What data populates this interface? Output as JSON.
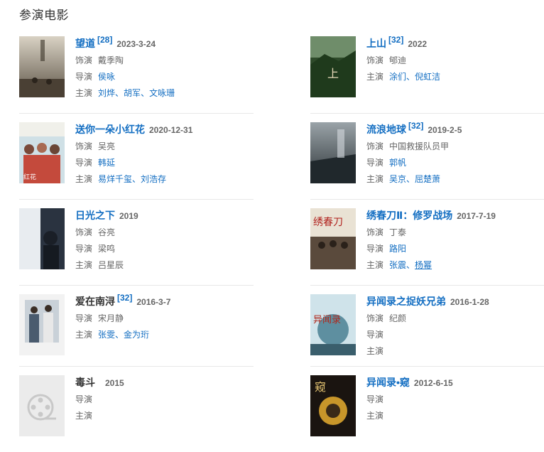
{
  "section_title": "参演电影",
  "labels": {
    "role": "饰演",
    "director": "导演",
    "cast": "主演"
  },
  "movies": [
    {
      "name": "望道",
      "badge": "[28]",
      "date": "2023-3-24",
      "role": "戴季陶",
      "director": "侯咏",
      "cast": [
        "刘烨",
        "胡军",
        "文咏珊"
      ]
    },
    {
      "name": "上山",
      "badge": "[32]",
      "date": "2022",
      "role": "郇迪",
      "cast": [
        "涂们",
        "倪虹洁"
      ]
    },
    {
      "name": "送你一朵小红花",
      "date": "2020-12-31",
      "role": "吴亮",
      "director": "韩延",
      "cast": [
        "易烊千玺",
        "刘浩存"
      ]
    },
    {
      "name": "流浪地球",
      "badge": "[32]",
      "date": "2019-2-5",
      "role": "中国救援队员甲",
      "director": "郭帆",
      "cast": [
        "吴京",
        "屈楚萧"
      ]
    },
    {
      "name": "日光之下",
      "date": "2019",
      "role": "谷亮",
      "director": "梁鸣",
      "cast": [
        "吕星辰"
      ]
    },
    {
      "name": "绣春刀Ⅱ：修罗战场",
      "date": "2017-7-19",
      "role": "丁泰",
      "director": "路阳",
      "cast": [
        "张震",
        "杨幂"
      ]
    },
    {
      "name": "爱在南浔",
      "badge": "[32]",
      "date": "2016-3-7",
      "director": "宋月静",
      "cast": [
        "张雯",
        "金为珩"
      ]
    },
    {
      "name": "异闻录之捉妖兄弟",
      "date": "2016-1-28",
      "role": "纪颜"
    },
    {
      "name": "毒斗",
      "date": "2015"
    },
    {
      "name": "异闻录•窥",
      "date": "2012-6-15"
    }
  ],
  "colors": {
    "link": "#136ec2",
    "label": "#666666",
    "divider": "#e8e8e8"
  }
}
